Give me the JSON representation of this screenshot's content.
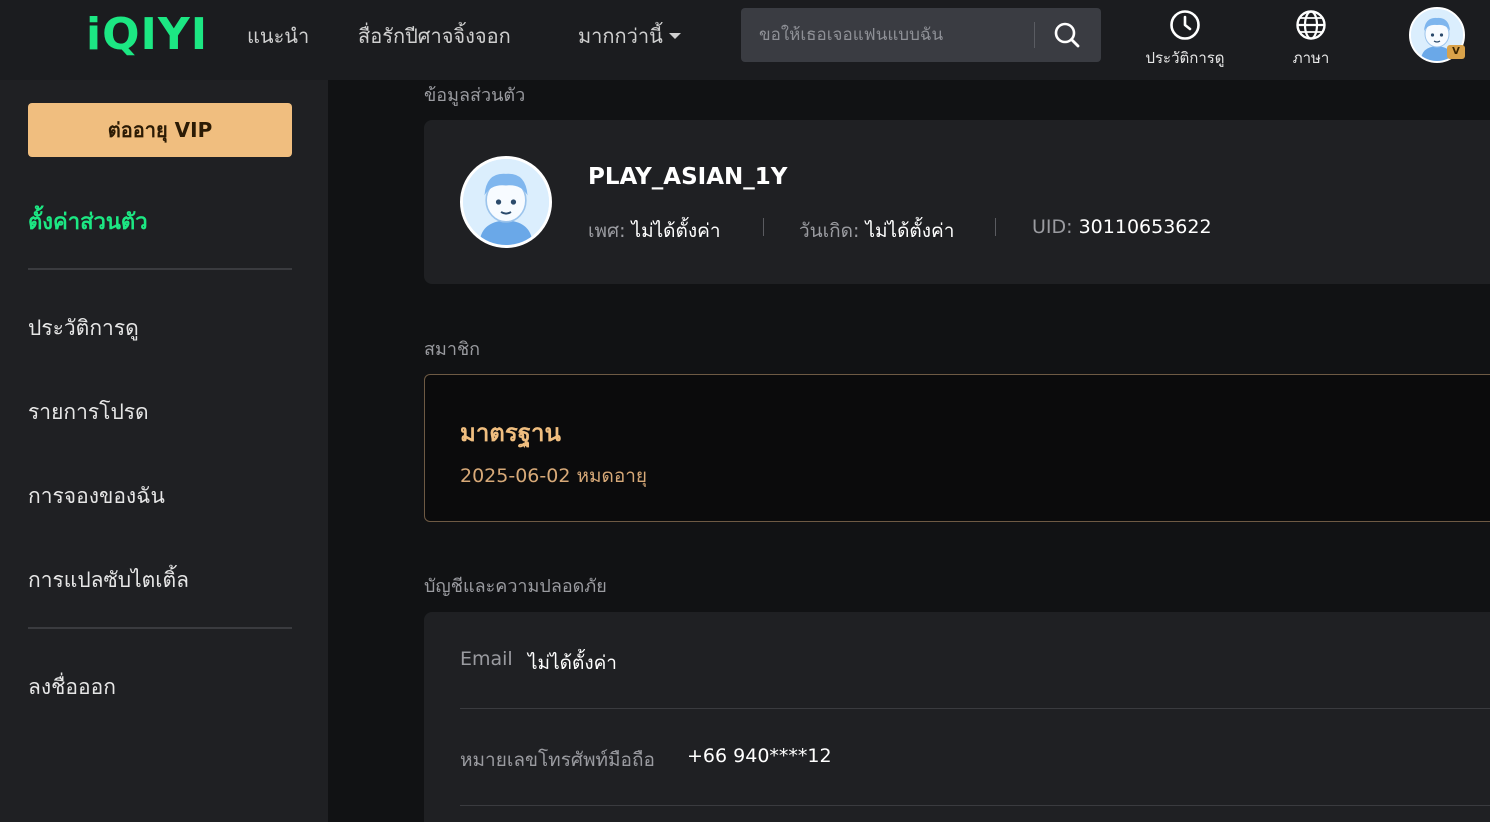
{
  "header": {
    "logo_text": "iQIYI",
    "nav": [
      {
        "label": "แนะนำ"
      },
      {
        "label": "สื่อรักปีศาจจิ้งจอก"
      },
      {
        "label": "มากกว่านี้"
      }
    ],
    "search": {
      "placeholder": "ขอให้เธอเจอแฟนแบบฉัน",
      "icon": "search-icon"
    },
    "actions": [
      {
        "label": "ประวัติการดู",
        "icon": "clock-icon"
      },
      {
        "label": "ภาษา",
        "icon": "globe-icon"
      }
    ],
    "vip_badge": "V"
  },
  "sidebar": {
    "renew_button": "ต่ออายุ VIP",
    "active_item": "ตั้งค่าส่วนตัว",
    "items": [
      {
        "label": "ประวัติการดู"
      },
      {
        "label": "รายการโปรด"
      },
      {
        "label": "การจองของฉัน"
      },
      {
        "label": "การแปลซับไตเติ้ล"
      }
    ],
    "logout": "ลงชื่อออก"
  },
  "profile": {
    "section_title": "ข้อมูลส่วนตัว",
    "username": "PLAY_ASIAN_1Y",
    "gender_label": "เพศ:",
    "gender_value": "ไม่ได้ตั้งค่า",
    "birthday_label": "วันเกิด:",
    "birthday_value": "ไม่ได้ตั้งค่า",
    "uid_label": "UID:",
    "uid_value": "30110653622"
  },
  "membership": {
    "section_title": "สมาชิก",
    "tier": "มาตรฐาน",
    "expiry_date": "2025-06-02",
    "expiry_suffix": "หมดอายุ"
  },
  "account": {
    "section_title": "บัญชีและความปลอดภัย",
    "email_label": "Email",
    "email_value": "ไม่ได้ตั้งค่า",
    "phone_label": "หมายเลขโทรศัพท์มือถือ",
    "phone_value": "+66 940****12"
  },
  "colors": {
    "brand_green": "#1ce783",
    "vip_gold": "#f0be7f",
    "header_bg": "#1b1c1f",
    "sidebar_bg": "#1f2023",
    "main_bg": "#111214"
  }
}
